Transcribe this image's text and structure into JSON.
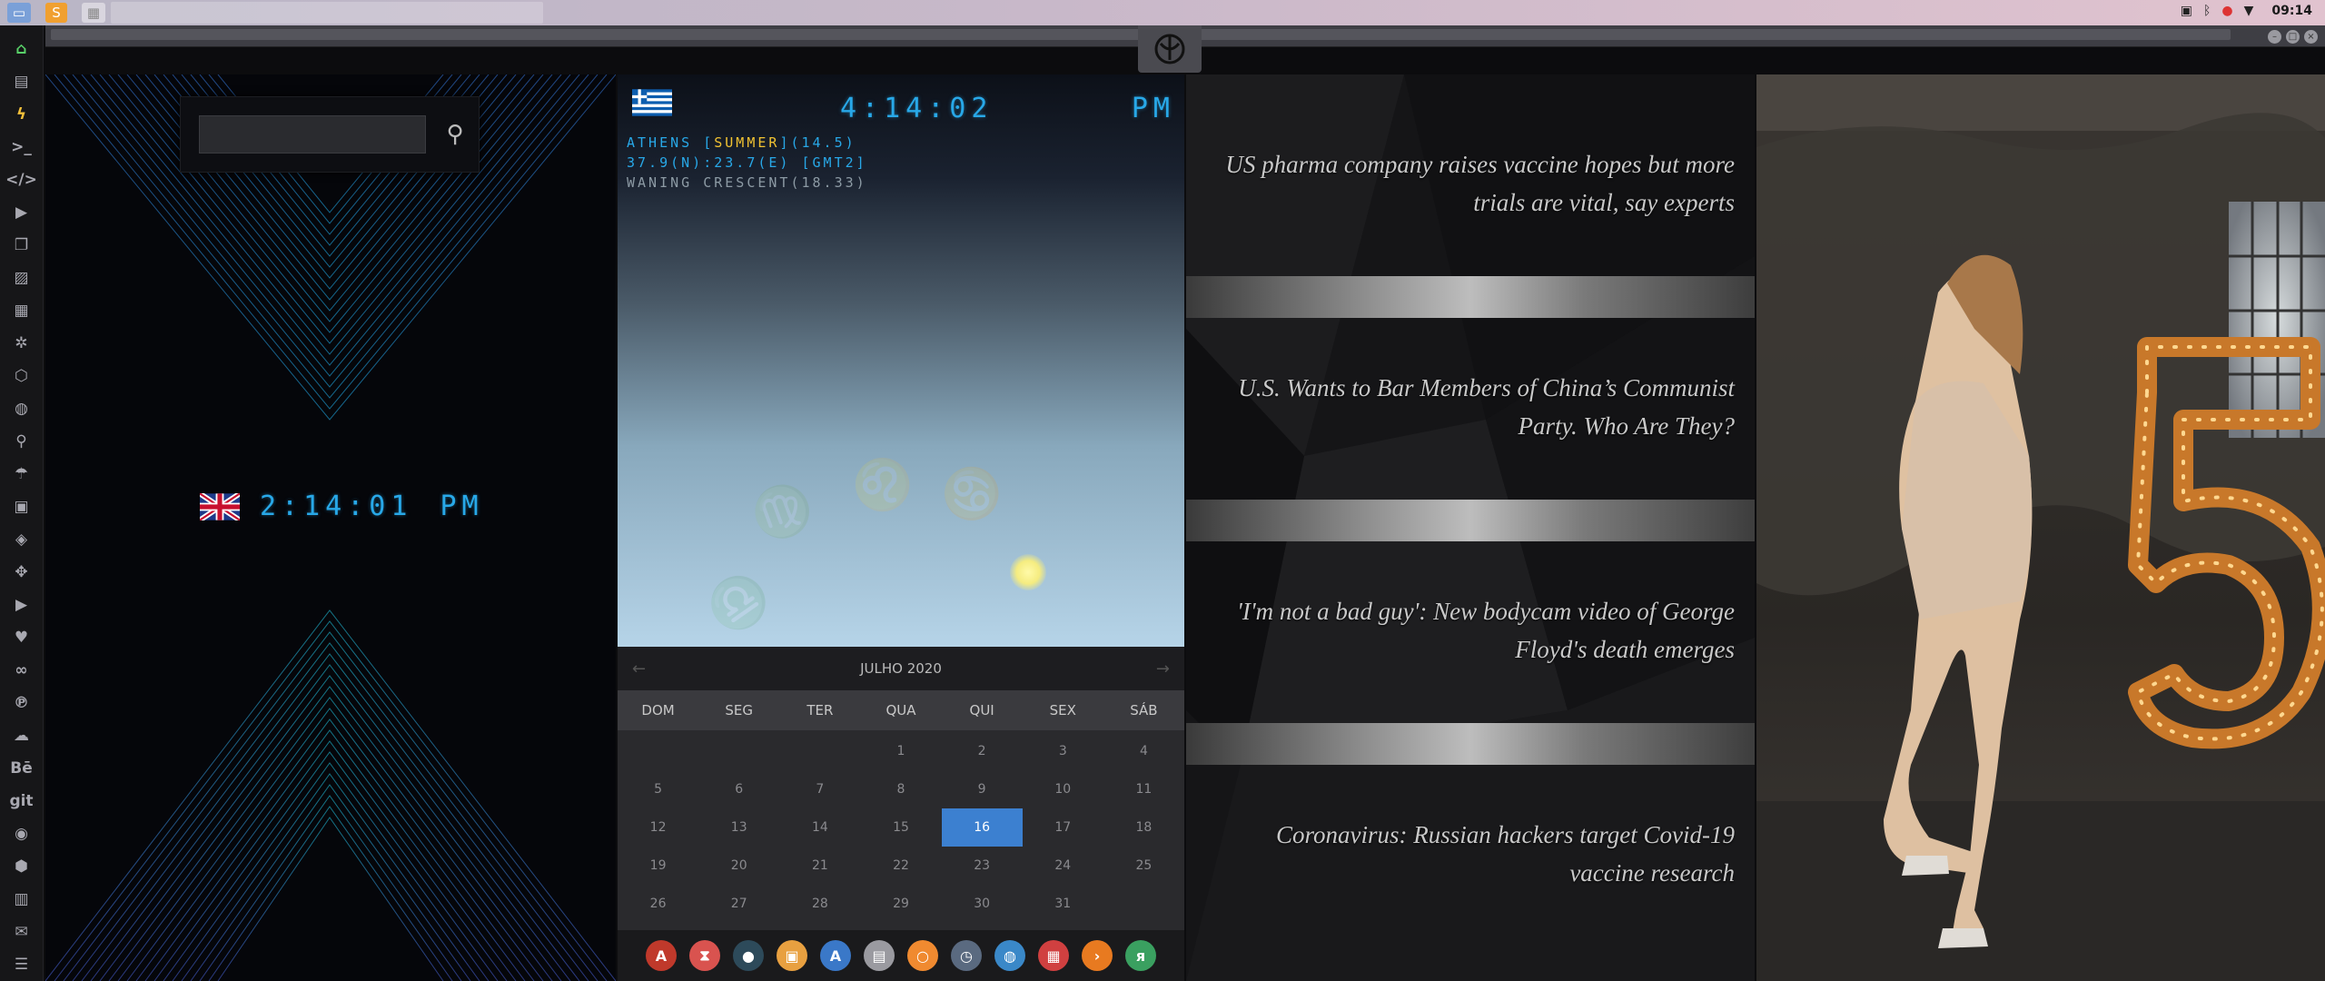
{
  "topbar": {
    "apps": [
      "files-icon",
      "sublime-icon",
      "grid-icon"
    ],
    "tray_icons": [
      "image-icon",
      "bluetooth-icon",
      "notification-icon",
      "wifi-icon"
    ],
    "time": "09:14"
  },
  "sidebar": {
    "items": [
      "home",
      "document",
      "bolt",
      "terminal",
      "code",
      "play",
      "copy",
      "image",
      "news",
      "gear",
      "hexagon",
      "globe",
      "search",
      "umbrella",
      "contact",
      "tag",
      "expand",
      "youtube",
      "heart",
      "link",
      "pinterest",
      "cloud",
      "Bē",
      "git",
      "github",
      "cubes",
      "map",
      "mail",
      "server"
    ]
  },
  "panel_uk": {
    "search_placeholder": "",
    "time": "2:14:01",
    "ampm": "PM"
  },
  "panel_greece": {
    "time": "4:14:02",
    "ampm": "PM",
    "city_prefix": "ATHENS [",
    "summer": "SUMMER",
    "city_suffix": "](14.5)",
    "coords": "37.9(N):23.7(E) [GMT2]",
    "moon": "WANING CRESCENT(18.33)"
  },
  "calendar": {
    "month": "JULHO 2020",
    "days": [
      "DOM",
      "SEG",
      "TER",
      "QUA",
      "QUI",
      "SEX",
      "SÁB"
    ],
    "cells": [
      "",
      "",
      "",
      "1",
      "2",
      "3",
      "4",
      "5",
      "6",
      "7",
      "8",
      "9",
      "10",
      "11",
      "12",
      "13",
      "14",
      "15",
      "16",
      "17",
      "18",
      "19",
      "20",
      "21",
      "22",
      "23",
      "24",
      "25",
      "26",
      "27",
      "28",
      "29",
      "30",
      "31",
      ""
    ],
    "today": "16"
  },
  "dock": {
    "icons": [
      {
        "name": "appcenter-icon",
        "color": "#c0392b",
        "glyph": "A"
      },
      {
        "name": "hourglass-icon",
        "color": "#d9534f",
        "glyph": "⧗"
      },
      {
        "name": "sphere-icon",
        "color": "#2d4a5a",
        "glyph": "●"
      },
      {
        "name": "photos-icon",
        "color": "#e8a040",
        "glyph": "▣"
      },
      {
        "name": "translate-icon",
        "color": "#3a78c8",
        "glyph": "A"
      },
      {
        "name": "notes-icon",
        "color": "#9a9aa0",
        "glyph": "▤"
      },
      {
        "name": "search-app-icon",
        "color": "#f08a30",
        "glyph": "○"
      },
      {
        "name": "clock-icon",
        "color": "#5a6a80",
        "glyph": "◷"
      },
      {
        "name": "browser-icon",
        "color": "#3a88c8",
        "glyph": "◍"
      },
      {
        "name": "calendar-icon",
        "color": "#d04040",
        "glyph": "▦"
      },
      {
        "name": "arrow-icon",
        "color": "#e87a20",
        "glyph": "›"
      },
      {
        "name": "yandex-icon",
        "color": "#3aa060",
        "glyph": "я"
      }
    ]
  },
  "news": {
    "items": [
      "US pharma company raises vaccine hopes but more trials are vital, say experts",
      "U.S. Wants to Bar Members of China’s Communist Party. Who Are They?",
      "'I'm not a bad guy': New bodycam video of George Floyd's death emerges",
      "Coronavirus: Russian hackers target Covid-19 vaccine research"
    ]
  },
  "colors": {
    "digital": "#28a8e8",
    "highlight": "#f1c232",
    "today": "#3c80d0"
  }
}
